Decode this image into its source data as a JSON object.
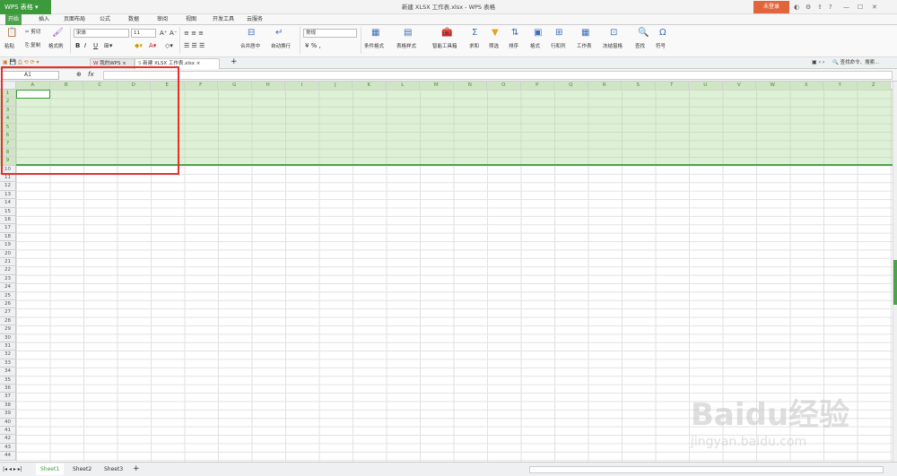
{
  "app": {
    "name": "WPS 表格",
    "title": "新建 XLSX 工作表.xlsx - WPS 表格",
    "login": "未登录"
  },
  "menu": [
    "开始",
    "插入",
    "页面布局",
    "公式",
    "数据",
    "审阅",
    "视图",
    "开发工具",
    "云服务"
  ],
  "ribbon": {
    "paste": "粘贴",
    "cut": "剪切",
    "copy": "复制",
    "format_painter": "格式刷",
    "font": "宋体",
    "size": "11",
    "bold": "B",
    "italic": "I",
    "underline": "U",
    "merge": "合并居中",
    "wrap": "自动换行",
    "number_format": "常规",
    "cond_format": "条件格式",
    "table_style": "表格样式",
    "smart_toolbox": "智能工具箱",
    "sum": "求和",
    "filter": "筛选",
    "sort": "排序",
    "format": "格式",
    "rowcol": "行和列",
    "sheet": "工作表",
    "freeze": "冻结窗格",
    "find": "查找",
    "symbol": "符号"
  },
  "doc_tabs": [
    "我的WPS",
    "新建 XLSX 工作表.xlsx"
  ],
  "search_placeholder": "查找命令、搜索...",
  "namebox": "A1",
  "fx": "fx",
  "columns": [
    "A",
    "B",
    "C",
    "D",
    "E",
    "F",
    "G",
    "H",
    "I",
    "J",
    "K",
    "L",
    "M",
    "N",
    "O",
    "P",
    "Q",
    "R",
    "S",
    "T",
    "U",
    "V",
    "W",
    "X",
    "Y",
    "Z"
  ],
  "row_count": 44,
  "sheets": [
    "Sheet1",
    "Sheet2",
    "Sheet3"
  ],
  "watermark": {
    "brand": "Baidu经验",
    "url": "jingyan.baidu.com"
  }
}
